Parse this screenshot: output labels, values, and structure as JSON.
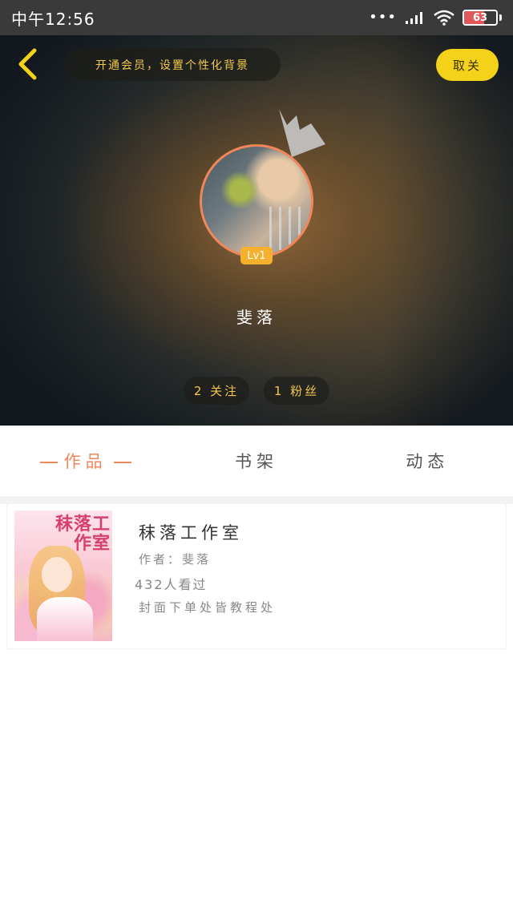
{
  "status_bar": {
    "time": "中午12:56",
    "signal_dots": "•••",
    "battery": "63",
    "battery_level": 0.63,
    "icons": [
      "signal-icon",
      "wifi-icon",
      "battery-icon"
    ]
  },
  "header": {
    "back_icon": "chevron-left-icon",
    "vip_banner": "开通会员，设置个性化背景",
    "unfollow_label": "取关",
    "accent_color": "#f5d21a"
  },
  "profile": {
    "crown_icon": "crown-icon",
    "level": "Lv1",
    "username": "斐落",
    "following": "2 关注",
    "followers": "1 粉丝"
  },
  "tabs": [
    {
      "label": "作品",
      "active": true
    },
    {
      "label": "书架",
      "active": false
    },
    {
      "label": "动态",
      "active": false
    }
  ],
  "book": {
    "cover_title": "秣落工作室",
    "title": "秣落工作室",
    "author": "作者：斐落",
    "views": "432人看过",
    "description": "封面下单处皆教程处"
  },
  "colors": {
    "tab_active": "#f0875a",
    "badge": "#f5b12e",
    "avatar_ring": "#f0875a"
  }
}
